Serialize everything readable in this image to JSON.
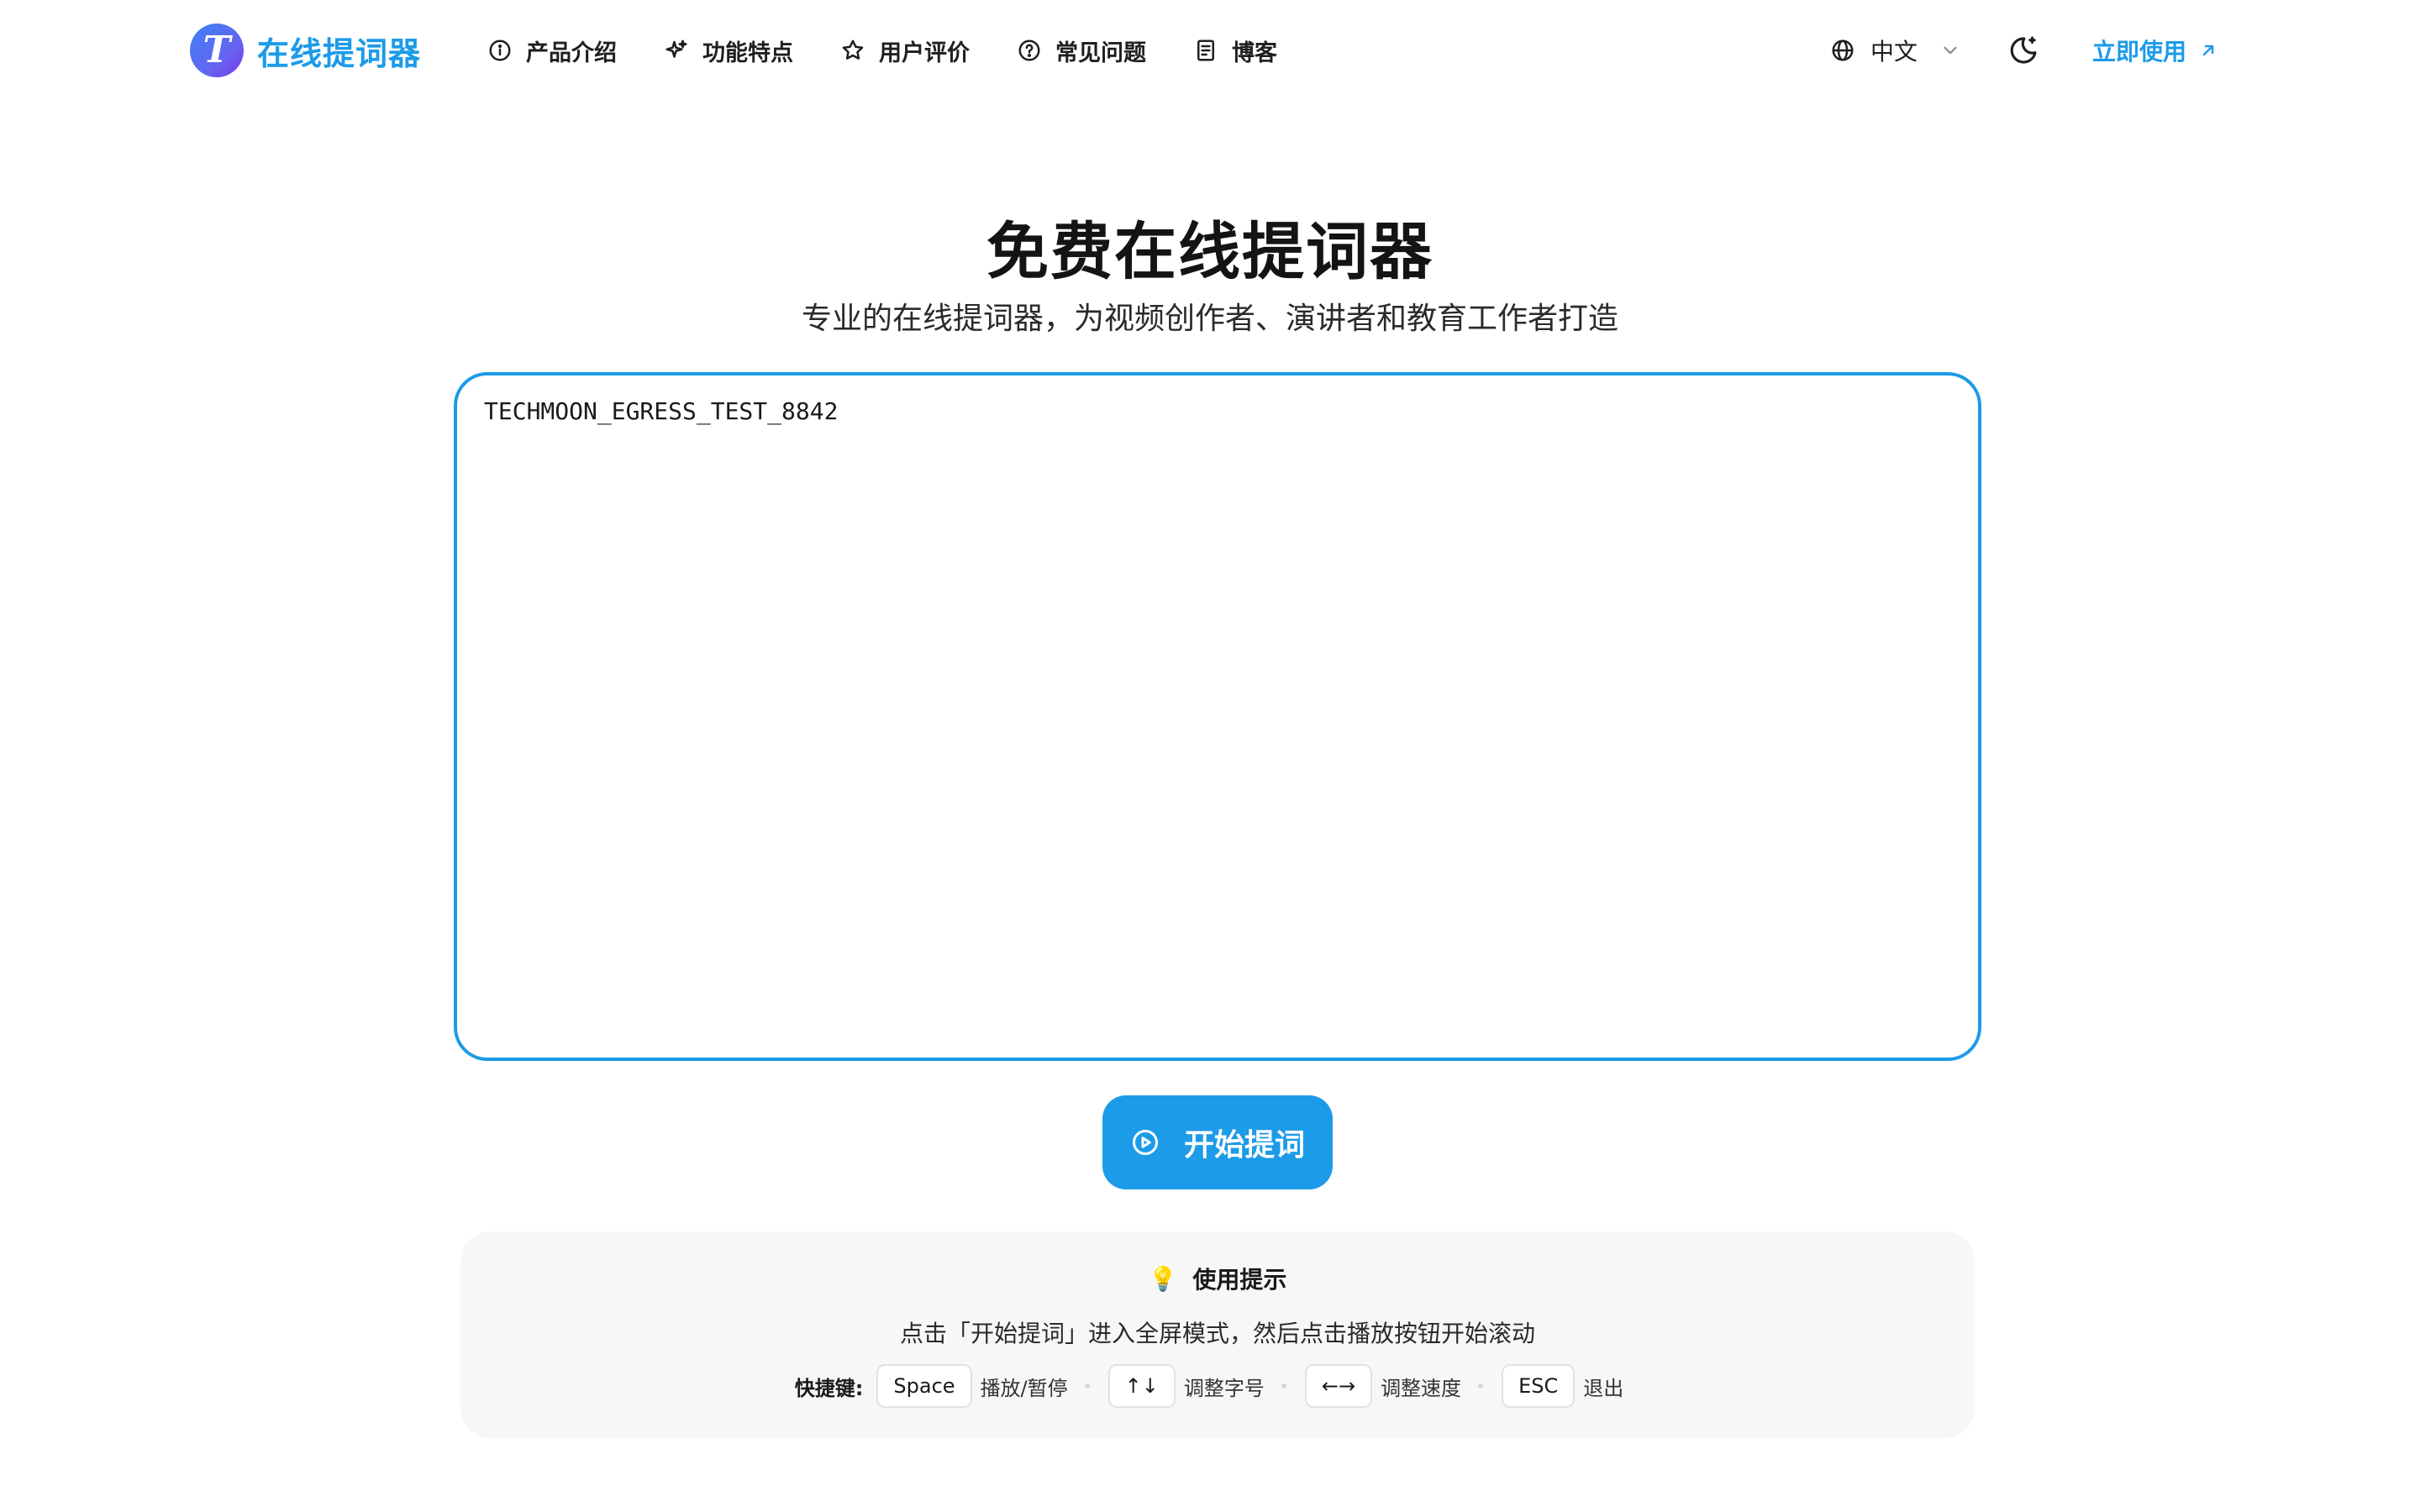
{
  "header": {
    "logo_letter": "T",
    "logo_text": "在线提词器",
    "nav": [
      {
        "label": "产品介绍",
        "icon": "info-icon"
      },
      {
        "label": "功能特点",
        "icon": "sparkles-icon"
      },
      {
        "label": "用户评价",
        "icon": "star-icon"
      },
      {
        "label": "常见问题",
        "icon": "help-circle-icon"
      },
      {
        "label": "博客",
        "icon": "document-icon"
      }
    ],
    "language": "中文",
    "cta_label": "立即使用"
  },
  "hero": {
    "title": "免费在线提词器",
    "subtitle": "专业的在线提词器，为视频创作者、演讲者和教育工作者打造"
  },
  "editor": {
    "value": "TECHMOON_EGRESS_TEST_8842"
  },
  "start_button": {
    "label": "开始提词"
  },
  "tips": {
    "title": "使用提示",
    "description": "点击「开始提词」进入全屏模式，然后点击播放按钮开始滚动",
    "shortcuts_label": "快捷键:",
    "shortcuts": [
      {
        "key": "Space",
        "action": "播放/暂停"
      },
      {
        "key": "↑↓",
        "action": "调整字号"
      },
      {
        "key": "←→",
        "action": "调整速度"
      },
      {
        "key": "ESC",
        "action": "退出"
      }
    ]
  },
  "colors": {
    "brand": "#1c9be8",
    "panel_bg": "#f7f7f7"
  }
}
